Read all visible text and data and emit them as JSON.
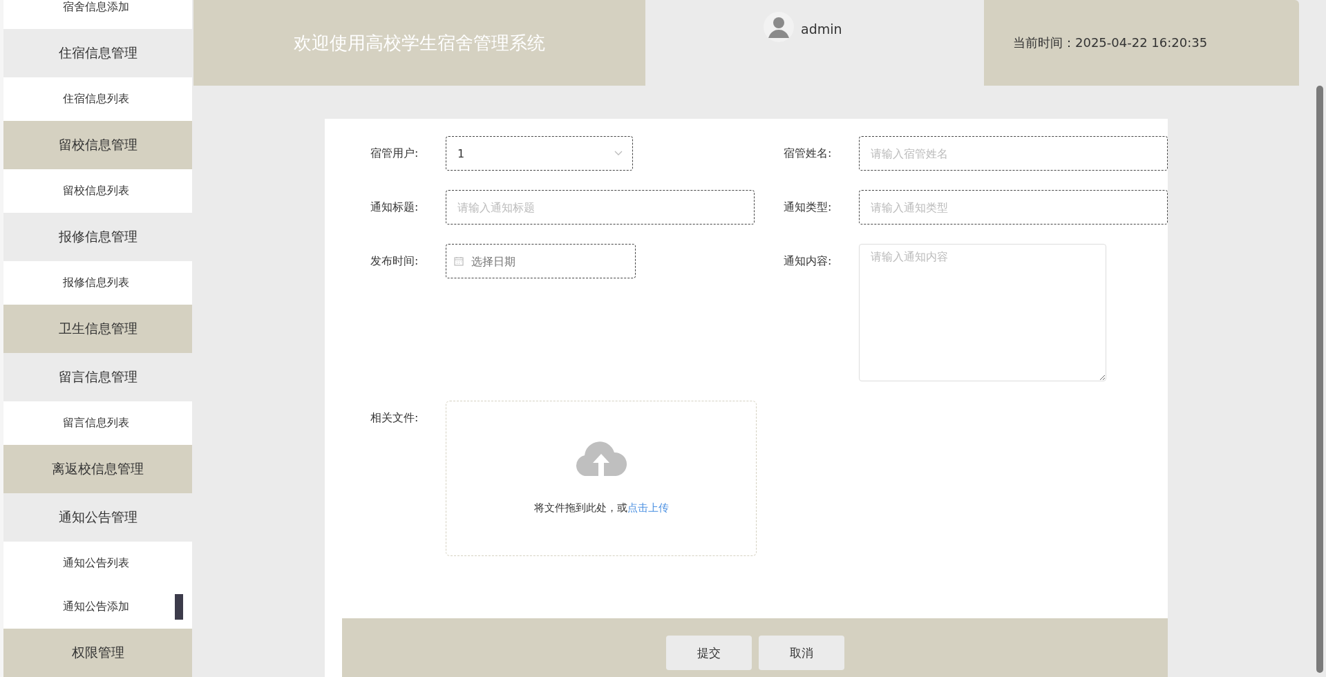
{
  "sidebar": {
    "items": [
      {
        "kind": "submenu",
        "label": "宿舍信息添加"
      },
      {
        "kind": "menu",
        "label": "住宿信息管理"
      },
      {
        "kind": "submenu",
        "label": "住宿信息列表"
      },
      {
        "kind": "menu",
        "label": "留校信息管理"
      },
      {
        "kind": "submenu",
        "label": "留校信息列表"
      },
      {
        "kind": "menu",
        "label": "报修信息管理"
      },
      {
        "kind": "submenu",
        "label": "报修信息列表"
      },
      {
        "kind": "menu",
        "label": "卫生信息管理"
      },
      {
        "kind": "menu",
        "label": "留言信息管理"
      },
      {
        "kind": "submenu",
        "label": "留言信息列表"
      },
      {
        "kind": "menu",
        "label": "离返校信息管理"
      },
      {
        "kind": "menu",
        "label": "通知公告管理"
      },
      {
        "kind": "submenu",
        "label": "通知公告列表"
      },
      {
        "kind": "submenu",
        "label": "通知公告添加"
      },
      {
        "kind": "menu",
        "label": "权限管理"
      }
    ]
  },
  "header": {
    "title": "欢迎使用高校学生宿舍管理系统",
    "user": "admin",
    "time_label": "当前时间：",
    "time": "2025-04-22 16:20:35"
  },
  "form": {
    "fields": [
      {
        "kind": "select",
        "label": "宿管用户:",
        "value": "1"
      },
      {
        "kind": "input",
        "label": "宿管姓名:",
        "placeholder": "请输入宿管姓名"
      },
      {
        "kind": "input",
        "label": "通知标题:",
        "placeholder": "请输入通知标题"
      },
      {
        "kind": "input",
        "label": "通知类型:",
        "placeholder": "请输入通知类型"
      },
      {
        "kind": "date",
        "label": "发布时间:",
        "placeholder": "选择日期"
      },
      {
        "kind": "textarea",
        "label": "通知内容:",
        "placeholder": "请输入通知内容"
      },
      {
        "kind": "upload",
        "label": "相关文件:",
        "text": "将文件拖到此处，或",
        "link": "点击上传"
      }
    ],
    "buttons": [
      "提交",
      "取消"
    ]
  }
}
